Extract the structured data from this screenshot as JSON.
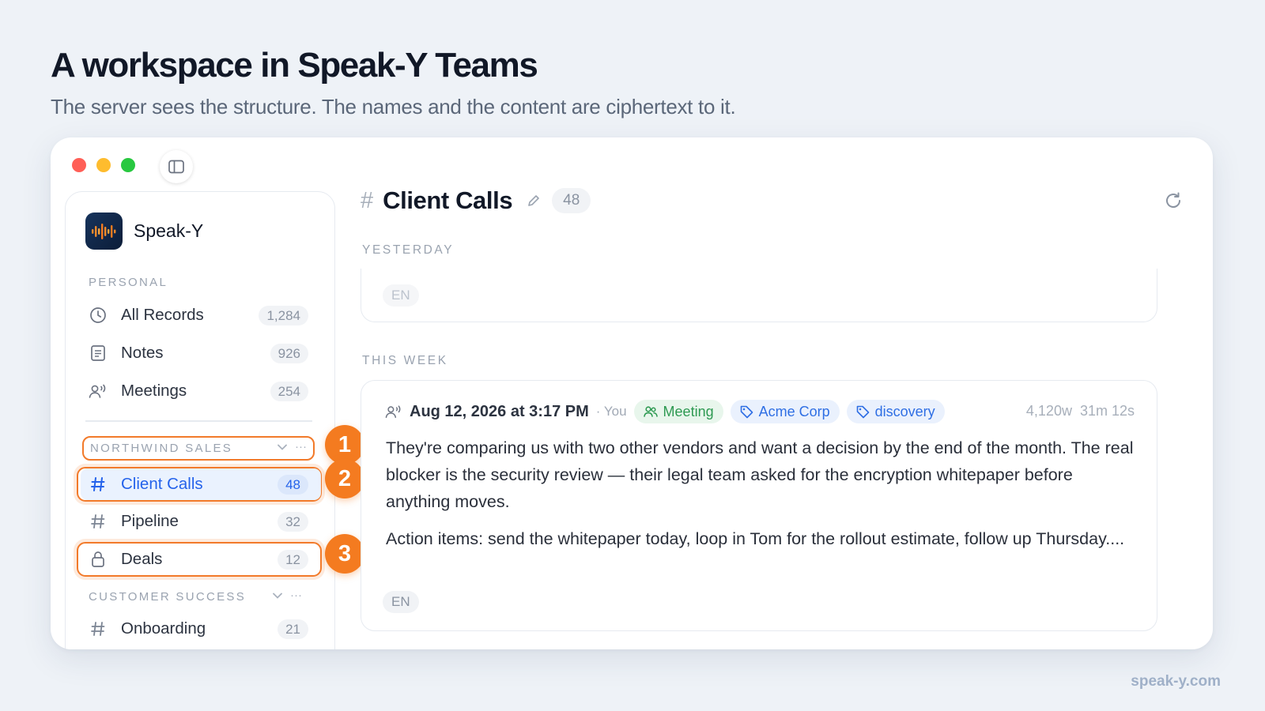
{
  "header": {
    "title": "A workspace in Speak-Y Teams",
    "subtitle": "The server sees the structure. The names and the content are ciphertext to it."
  },
  "footer": {
    "url": "speak-y.com"
  },
  "colors": {
    "accent": "#2563eb",
    "callout": "#f47b20",
    "meeting_tag": "#2e9a52",
    "topic_tag": "#2f6fe4"
  },
  "sidebar": {
    "brand": {
      "name": "Speak-Y",
      "icon": "waveform-logo"
    },
    "personal": {
      "label": "PERSONAL",
      "items": [
        {
          "label": "All Records",
          "count": "1,284",
          "icon": "clock-icon"
        },
        {
          "label": "Notes",
          "count": "926",
          "icon": "note-icon"
        },
        {
          "label": "Meetings",
          "count": "254",
          "icon": "meeting-icon"
        }
      ]
    },
    "groups": [
      {
        "label": "NORTHWIND SALES",
        "items": [
          {
            "label": "Client Calls",
            "count": "48",
            "icon": "hash-icon",
            "active": true
          },
          {
            "label": "Pipeline",
            "count": "32",
            "icon": "hash-icon"
          },
          {
            "label": "Deals",
            "count": "12",
            "icon": "lock-icon"
          }
        ]
      },
      {
        "label": "CUSTOMER SUCCESS",
        "items": [
          {
            "label": "Onboarding",
            "count": "21",
            "icon": "hash-icon"
          }
        ]
      }
    ],
    "group_menu": "···"
  },
  "callouts": [
    "1",
    "2",
    "3"
  ],
  "main": {
    "hash": "#",
    "title": "Client Calls",
    "count": "48",
    "sections": [
      {
        "label": "YESTERDAY",
        "cards": [
          {
            "language": "EN"
          }
        ]
      },
      {
        "label": "THIS WEEK",
        "cards": [
          {
            "date": "Aug 12, 2026 at 3:17 PM",
            "owner": "· You",
            "tags": [
              "Meeting",
              "Acme Corp",
              "discovery"
            ],
            "words": "4,120w",
            "duration": "31m 12s",
            "paragraphs": [
              "They're comparing us with two other vendors and want a decision by the end of the month. The real blocker is the security review — their legal team asked for the encryption whitepaper before anything moves.",
              "Action items: send the whitepaper today, loop in Tom for the rollout estimate, follow up Thursday...."
            ],
            "language": "EN"
          }
        ]
      }
    ]
  }
}
